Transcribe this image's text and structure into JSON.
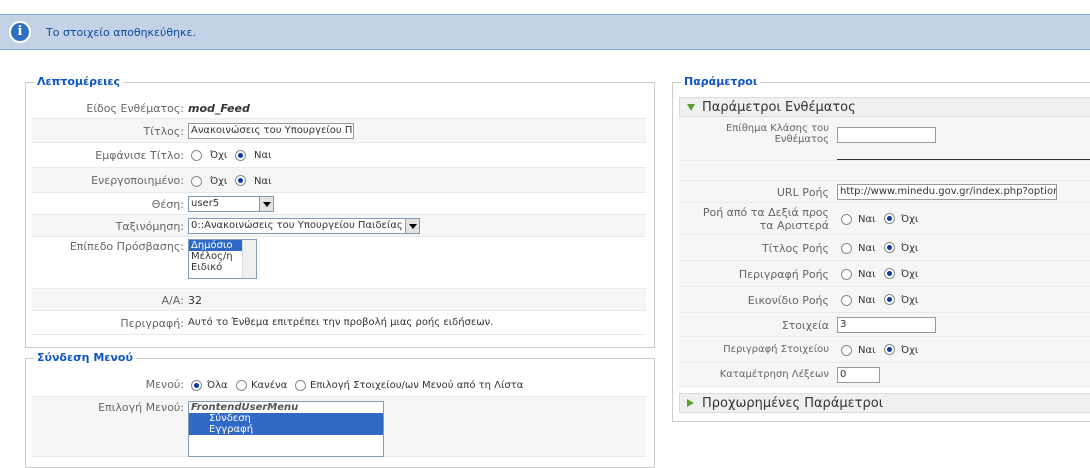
{
  "message": {
    "text": "Το στοιχείο αποθηκεύθηκε."
  },
  "details": {
    "legend": "Λεπτομέρειες",
    "type_label": "Είδος Ενθέματος:",
    "type_value": "mod_Feed",
    "title_label": "Τίτλος:",
    "title_value": "Ανακοινώσεις του Υπουργείου Πα",
    "show_title_label": "Εμφάνισε Τίτλο:",
    "enabled_label": "Ενεργοποιημένο:",
    "no_label": "Όχι",
    "yes_label": "Ναι",
    "position_label": "Θέση:",
    "position_value": "user5",
    "order_label": "Ταξινόμηση:",
    "order_value": "0::Ανακοινώσεις του Υπουργείου Παιδείας",
    "access_label": "Επίπεδο Πρόσβασης:",
    "access_options": [
      "Δημόσιο",
      "Μέλος/η",
      "Ειδικό"
    ],
    "id_label": "Α/Α:",
    "id_value": "32",
    "desc_label": "Περιγραφή:",
    "desc_value": "Αυτό το Ένθεμα επιτρέπει την προβολή μιας ροής ειδήσεων."
  },
  "menu_link": {
    "legend": "Σύνδεση Μενού",
    "menus_label": "Μενού:",
    "opt_all": "Όλα",
    "opt_none": "Κανένα",
    "opt_select": "Επιλογή Στοιχείου/ων Μενού από τη Λίστα",
    "select_label": "Επιλογή Μενού:",
    "list_items": [
      "FrontendUserMenu",
      "Σύνδεση",
      "Εγγραφή"
    ]
  },
  "params": {
    "legend": "Παράμετροι",
    "module_params_title": "Παράμετροι Ενθέματος",
    "class_suffix_label": "Επίθημα Κλάσης του Ενθέματος",
    "class_suffix_value": "",
    "url_label": "URL Ροής",
    "url_value": "http://www.minedu.gov.gr/index.php?option=c",
    "rtl_label": "Ροή από τα Δεξιά προς τα Αριστερά",
    "feed_title_label": "Τίτλος Ροής",
    "feed_desc_label": "Περιγραφή Ροής",
    "feed_image_label": "Εικονίδιο Ροής",
    "items_label": "Στοιχεία",
    "items_value": "3",
    "item_desc_label": "Περιγραφή Στοιχείου",
    "word_count_label": "Καταμέτρηση Λέξεων",
    "word_count_value": "0",
    "yes_label": "Ναι",
    "no_label": "Όχι",
    "advanced_title": "Προχωρημένες Παράμετροι"
  },
  "colors": {
    "accent": "#0b55c4",
    "message_bg": "#c3d2e5",
    "selected": "#3169c6"
  }
}
